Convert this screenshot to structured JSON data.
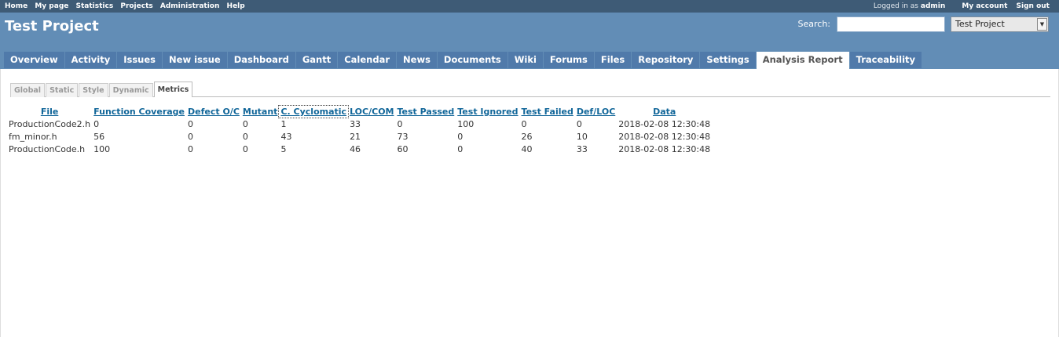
{
  "top_menu": {
    "links": [
      "Home",
      "My page",
      "Statistics",
      "Projects",
      "Administration",
      "Help"
    ],
    "logged_in_label": "Logged in as",
    "user": "admin",
    "my_account": "My account",
    "sign_out": "Sign out"
  },
  "header": {
    "title": "Test Project",
    "search_label": "Search:",
    "search_value": "",
    "project_select": "Test Project"
  },
  "main_menu": {
    "tabs": [
      "Overview",
      "Activity",
      "Issues",
      "New issue",
      "Dashboard",
      "Gantt",
      "Calendar",
      "News",
      "Documents",
      "Wiki",
      "Forums",
      "Files",
      "Repository",
      "Settings",
      "Analysis Report",
      "Traceability"
    ],
    "selected": "Analysis Report"
  },
  "subtabs": {
    "items": [
      "Global",
      "Static",
      "Style",
      "Dynamic",
      "Metrics"
    ],
    "active": "Metrics"
  },
  "table": {
    "headers": [
      "File",
      "Function Coverage",
      "Defect O/C",
      "Mutant",
      "C. Cyclomatic",
      "LOC/COM",
      "Test Passed",
      "Test Ignored",
      "Test Failed",
      "Def/LOC",
      "Data"
    ],
    "sorted_column": "C. Cyclomatic",
    "rows": [
      [
        "ProductionCode2.h",
        "0",
        "0",
        "0",
        "1",
        "33",
        "0",
        "100",
        "0",
        "0",
        "2018-02-08 12:30:48"
      ],
      [
        "fm_minor.h",
        "56",
        "0",
        "0",
        "43",
        "21",
        "73",
        "0",
        "26",
        "10",
        "2018-02-08 12:30:48"
      ],
      [
        "ProductionCode.h",
        "100",
        "0",
        "0",
        "5",
        "46",
        "60",
        "0",
        "40",
        "33",
        "2018-02-08 12:30:48"
      ]
    ]
  },
  "colors": {
    "top_bar": "#3e5b76",
    "header": "#628db6",
    "tab": "#507aaa",
    "link": "#116699"
  }
}
